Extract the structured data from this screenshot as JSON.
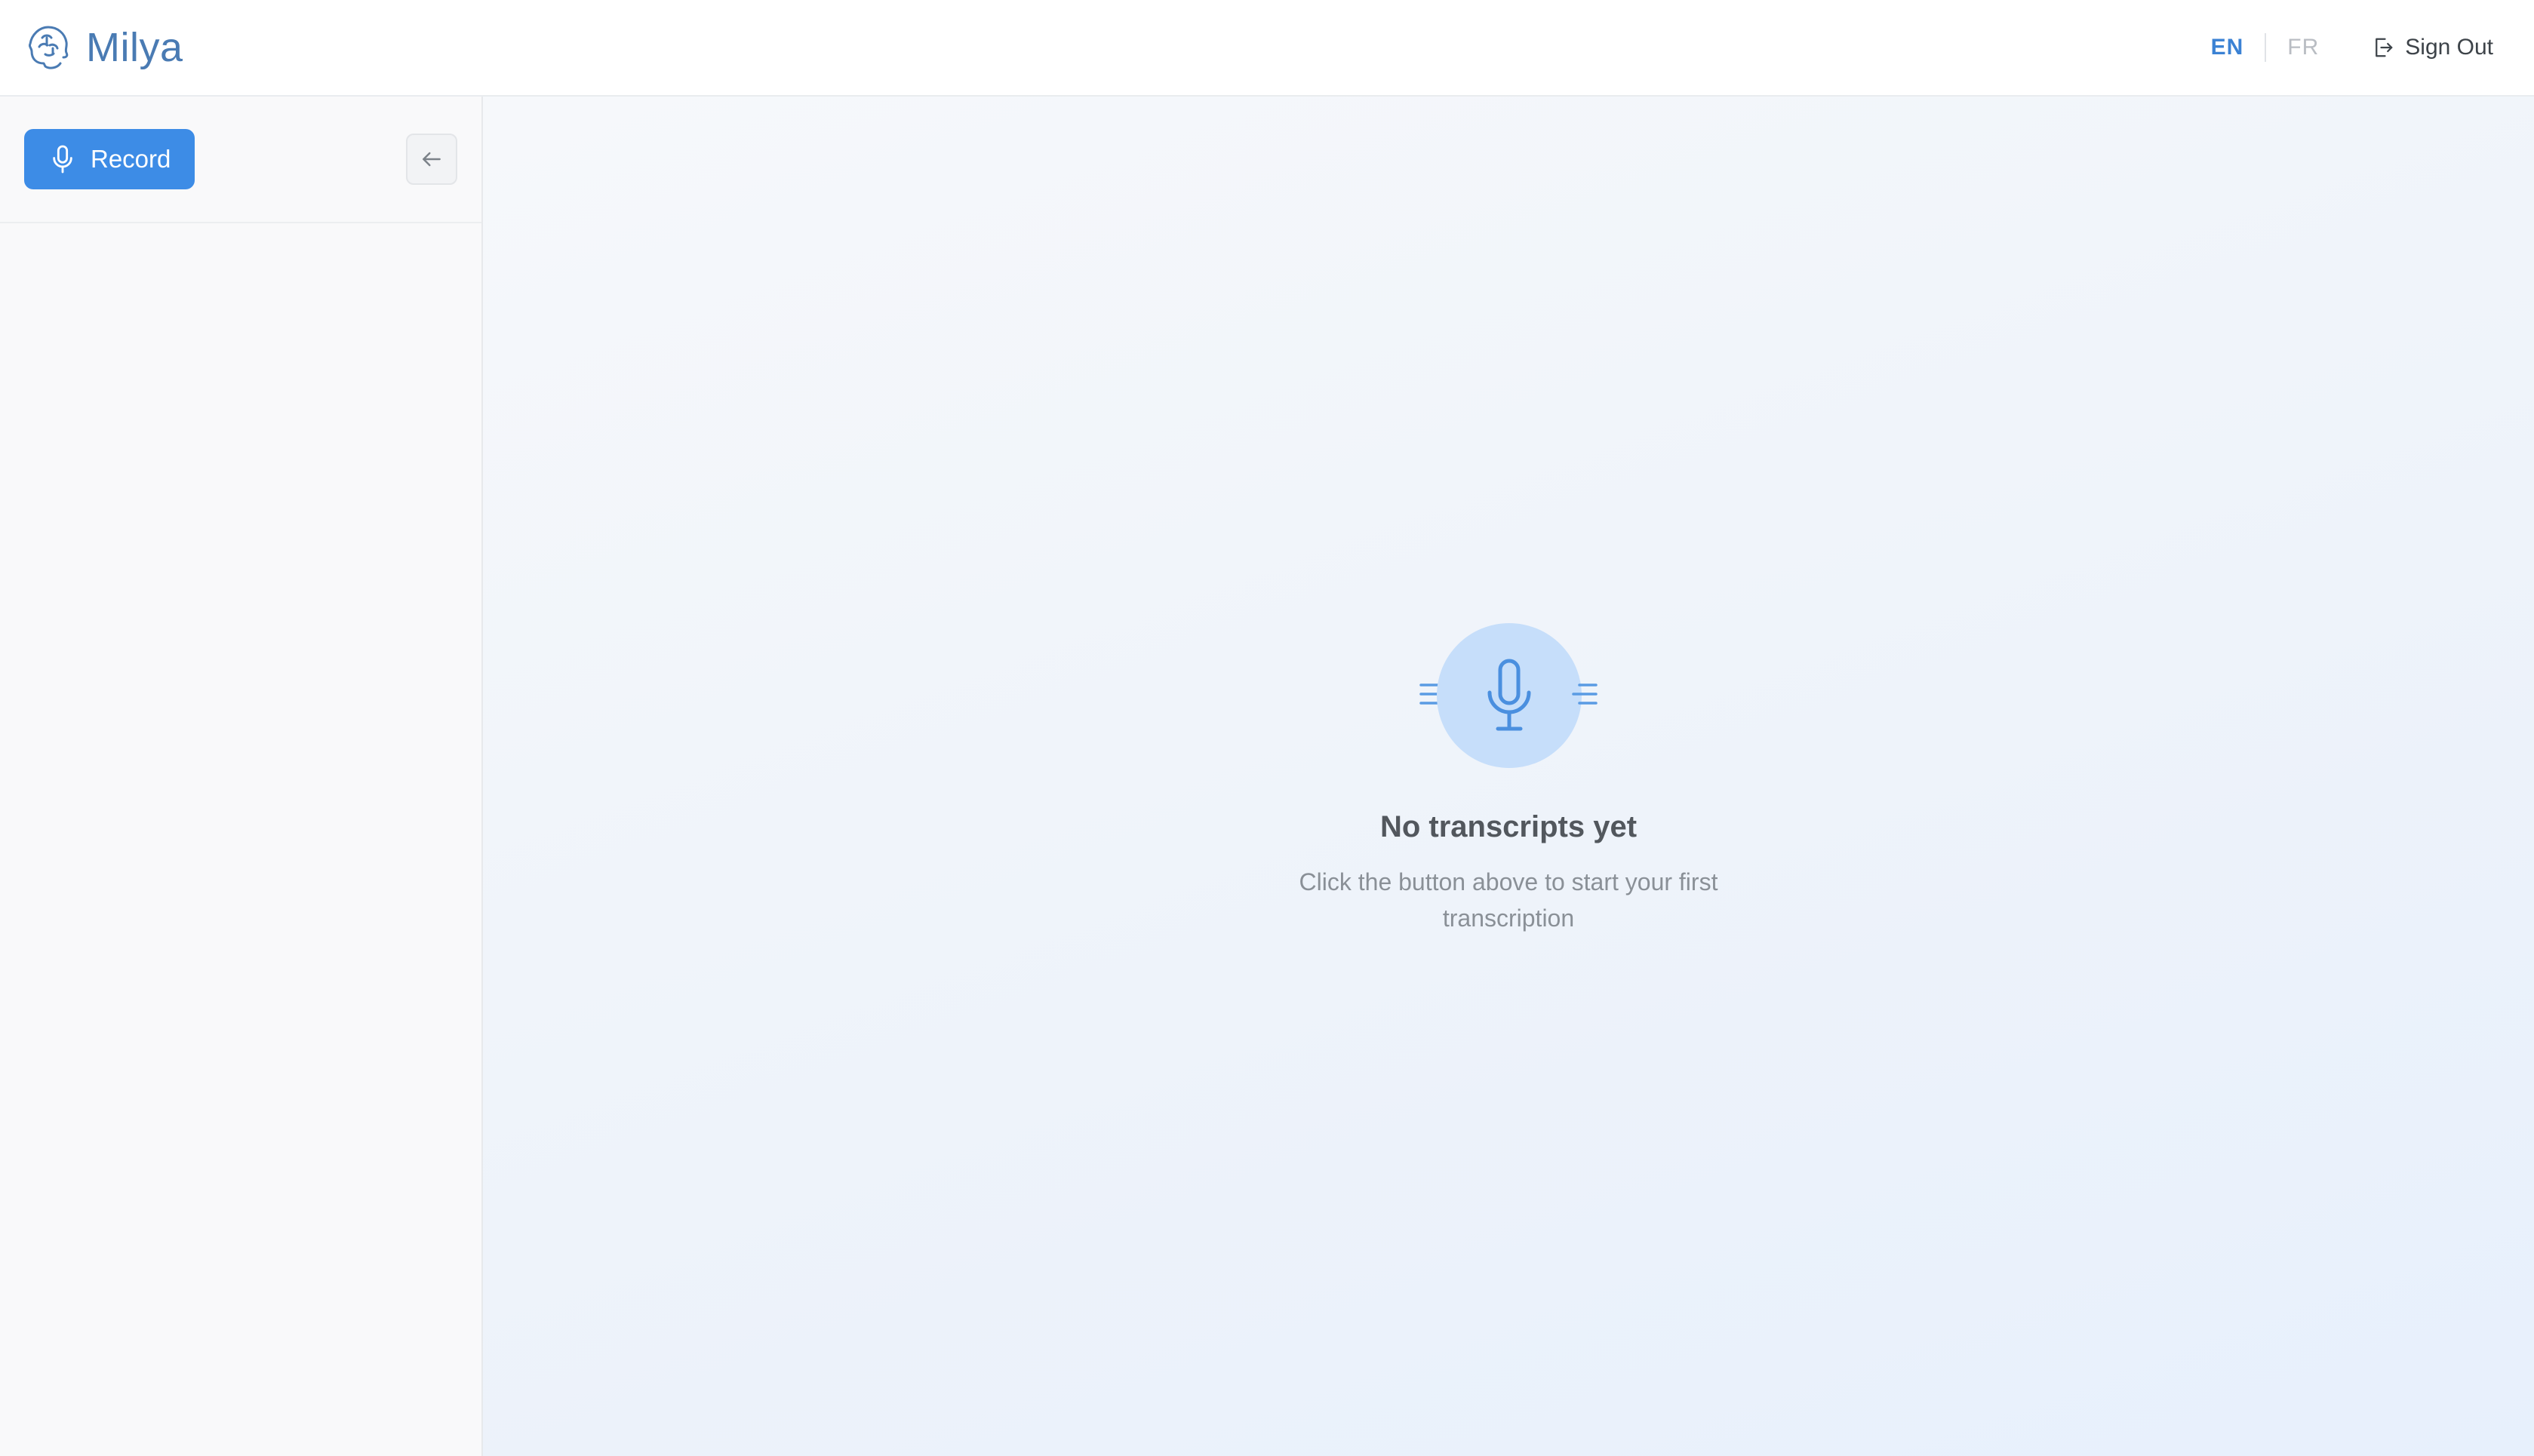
{
  "app": {
    "name": "Milya",
    "logo_icon": "brain-head-icon"
  },
  "header": {
    "languages": [
      "EN",
      "FR"
    ],
    "active_language": "EN",
    "sign_out_label": "Sign Out",
    "sign_out_icon": "sign-out-icon"
  },
  "sidebar": {
    "record_label": "Record",
    "record_icon": "microphone-icon",
    "collapse_icon": "arrow-left-icon"
  },
  "main": {
    "empty_state": {
      "icon": "microphone-icon",
      "title": "No transcripts yet",
      "subtitle": "Click the button above to start your first transcription"
    }
  },
  "colors": {
    "brand": "#4a7bb3",
    "accent": "#3d8ce6",
    "active_language": "#3b82d4",
    "empty_icon_bg": "#c6defa"
  }
}
